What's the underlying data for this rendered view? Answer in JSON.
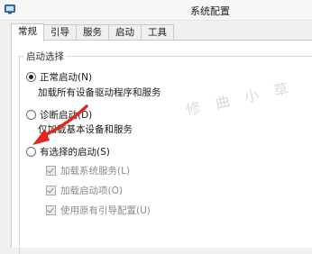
{
  "window": {
    "title": "系统配置"
  },
  "tabs": [
    {
      "label": "常规",
      "active": true
    },
    {
      "label": "引导",
      "active": false
    },
    {
      "label": "服务",
      "active": false
    },
    {
      "label": "启动",
      "active": false
    },
    {
      "label": "工具",
      "active": false
    }
  ],
  "startup_group": {
    "legend": "启动选择",
    "normal": {
      "label": "正常启动(N)",
      "desc": "加载所有设备驱动程序和服务",
      "selected": true
    },
    "diagnostic": {
      "label": "诊断启动(D)",
      "desc": "仅加载基本设备和服务",
      "selected": false
    },
    "selective": {
      "label": "有选择的启动(S)",
      "selected": false
    },
    "options": [
      {
        "label": "加载系统服务(L)",
        "checked": true,
        "enabled": false
      },
      {
        "label": "加载启动项(O)",
        "checked": true,
        "enabled": false
      },
      {
        "label": "使用原有引导配置(U)",
        "checked": true,
        "enabled": false
      }
    ]
  },
  "watermark": "修 曲 小 草",
  "colors": {
    "arrow": "#e0281e",
    "panel_bg": "#ffffff",
    "window_bg": "#f0f0f0"
  }
}
